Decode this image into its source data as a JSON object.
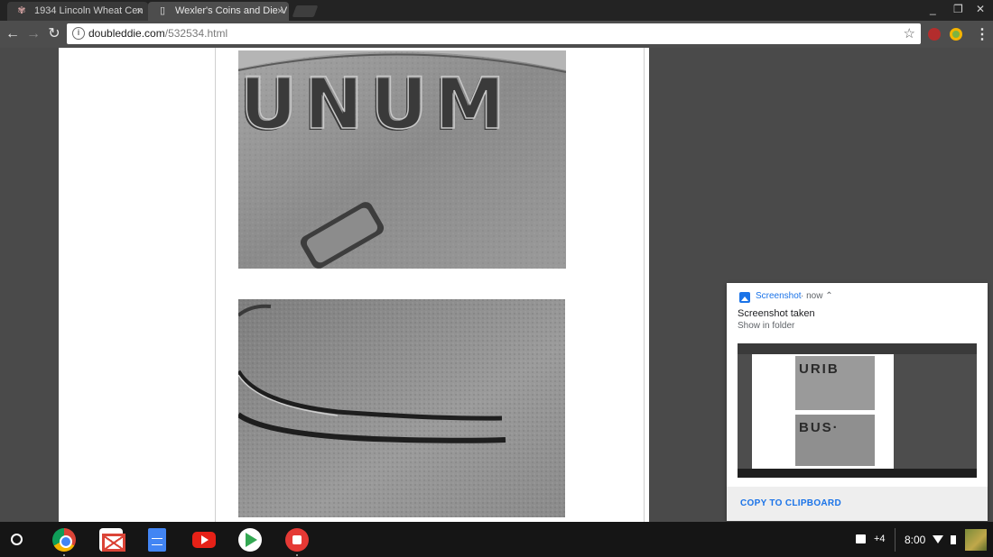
{
  "tabs": [
    {
      "title": "1934 Lincoln Wheat Cen",
      "favicon": "coin-favicon-icon",
      "active": false
    },
    {
      "title": "Wexler's Coins and Die V",
      "favicon": "page-icon",
      "active": true
    }
  ],
  "toolbar": {
    "url_host": "doubleddie.com",
    "url_path": "/532534.html"
  },
  "notification": {
    "app_name": "Screenshot",
    "time": "· now ⌃",
    "title": "Screenshot taken",
    "subtitle": "Show in folder",
    "thumbnail_text_top": "URIB",
    "thumbnail_text_bottom": "BUS·",
    "action": "COPY TO CLIPBOARD"
  },
  "coin_images": [
    {
      "letters": "UNUM"
    },
    {
      "letters": ""
    }
  ],
  "shelf": {
    "apps": [
      "chrome-icon",
      "gmail-icon",
      "docs-icon",
      "youtube-icon",
      "play-store-icon",
      "photos-icon"
    ],
    "notification_count": "+4",
    "time": "8:00"
  },
  "colors": {
    "accent": "#1a73e8",
    "tabstrip": "#232323",
    "toolbar": "#4d4d4d",
    "shelf": "#151515"
  }
}
